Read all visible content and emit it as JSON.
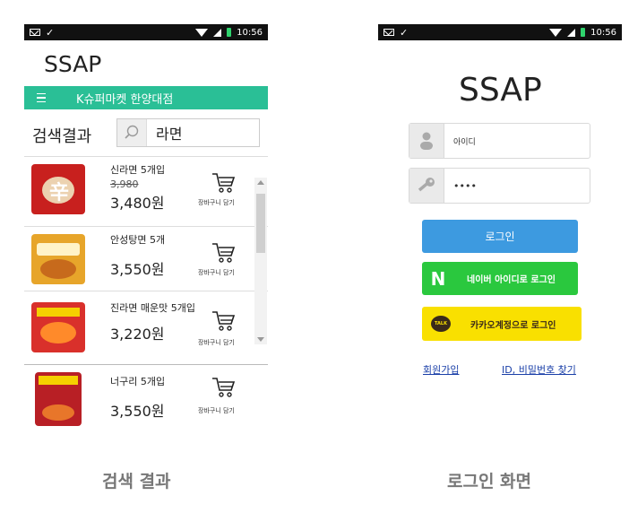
{
  "left_screen": {
    "status": {
      "time": "10:56"
    },
    "app_title": "SSAP",
    "store_name": "K슈퍼마켓 한양대점",
    "search": {
      "label": "검색결과",
      "query": "라면"
    },
    "results": [
      {
        "name": "신라면 5개입",
        "old_price": "3,980",
        "price": "3,480원",
        "cart_label": "장바구니 담기",
        "thumb_color": "#c8201e"
      },
      {
        "name": "안성탕면 5개",
        "old_price": "",
        "price": "3,550원",
        "cart_label": "장바구니 담기",
        "thumb_color": "#e7a52a"
      },
      {
        "name": "진라면 매운맛 5개입",
        "old_price": "",
        "price": "3,220원",
        "cart_label": "장바구니 담기",
        "thumb_color": "#d9302b"
      },
      {
        "name": "너구리 5개입",
        "old_price": "",
        "price": "3,550원",
        "cart_label": "장바구니 담기",
        "thumb_color": "#b81f25"
      }
    ],
    "caption": "검색 결과"
  },
  "right_screen": {
    "status": {
      "time": "10:56"
    },
    "app_title": "SSAP",
    "id_field": {
      "placeholder": "아이디"
    },
    "password_field": {
      "value": "••••"
    },
    "login_button": "로그인",
    "naver_button": {
      "badge": "N",
      "label": "네이버 아이디로 로그인"
    },
    "kakao_button": {
      "badge": "TALK",
      "label": "카카오계정으로 로그인"
    },
    "signup_link": "회원가입",
    "find_link": "ID, 비밀번호 찾기",
    "caption": "로그인 화면"
  },
  "colors": {
    "accent_teal": "#2abf96",
    "login_blue": "#3d9ae0",
    "naver_green": "#2ac83e",
    "kakao_yellow": "#f9e000"
  }
}
